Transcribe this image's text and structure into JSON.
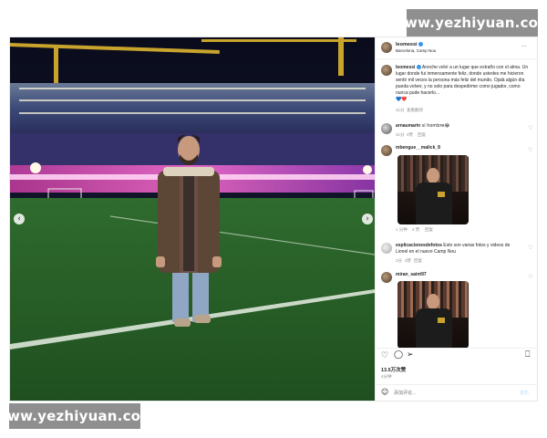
{
  "watermark": {
    "text": "www.yezhiyuan.com"
  },
  "post": {
    "author": {
      "username": "leomessi",
      "location": "Barcelona, Camp Nou",
      "more": "···"
    },
    "caption": {
      "username": "leomessi",
      "text": "Anoche volví a un lugar que extraño con el alma. Un lugar donde fui inmensamente feliz, donde ustedes me hicieron sentir mil veces la persona más feliz del mundo. Ojalá algún día pueda volver, y no solo para despedirme como jugador, como nunca pude hacerlo...",
      "emojis": "💙❤️",
      "time": "41分",
      "translate": "查看翻译"
    },
    "comments": [
      {
        "username": "arnaumarin",
        "text": "si hombre😂",
        "time": "41分",
        "likes": "4赞",
        "reply": "回复"
      },
      {
        "username": "mbengue__malick_8",
        "text": "",
        "time": "1 分钟",
        "likes": "4 赞",
        "reply": "回复"
      },
      {
        "username": "explicacionesdefotos",
        "text": "Esto son varias fotos y videos de Lionel en el nuevo Camp Nou",
        "time": "2分",
        "likes": "3赞",
        "reply": "回复"
      },
      {
        "username": "miran_saint97",
        "text": "",
        "time": "",
        "likes": "",
        "reply": ""
      }
    ],
    "likes_count": "13.5万次赞",
    "post_time": "4分钟",
    "comment_placeholder": "添加评论...",
    "post_button": "发布",
    "icons": {
      "heart": "heart-icon",
      "comment": "comment-icon",
      "share": "share-icon",
      "save": "bookmark-icon",
      "emoji": "emoji-icon"
    },
    "carousel": {
      "slides": 4,
      "active": 2
    }
  },
  "colors": {
    "accent": "#3897f0",
    "verified": "#3897f0",
    "text": "#262626",
    "muted": "#8e8e8e"
  }
}
